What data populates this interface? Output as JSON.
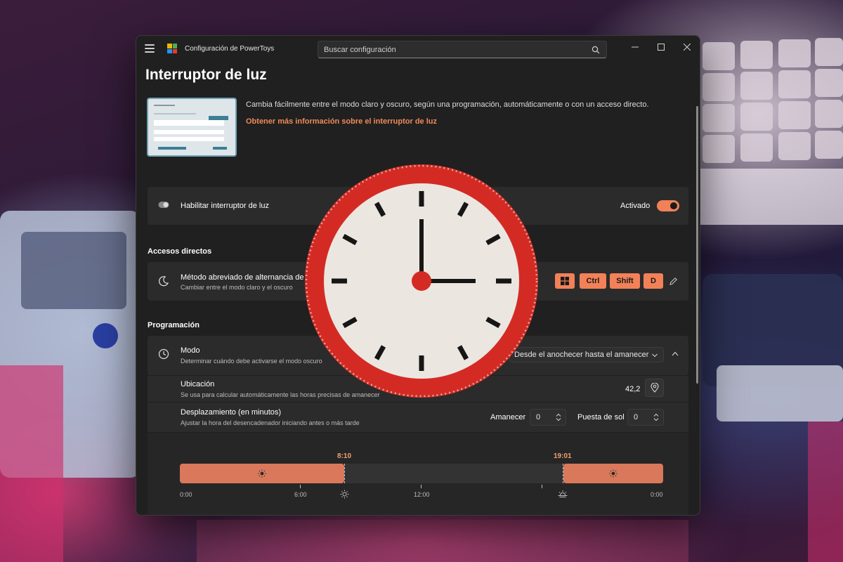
{
  "window": {
    "app_title": "Configuración de PowerToys",
    "search_placeholder": "Buscar configuración"
  },
  "page": {
    "title": "Interruptor de luz",
    "description": "Cambia fácilmente entre el modo claro y oscuro, según una programación, automáticamente o con un acceso directo.",
    "learn_more_link": "Obtener más información sobre el interruptor de luz"
  },
  "enable": {
    "label": "Habilitar interruptor de luz",
    "state_label": "Activado",
    "enabled": true
  },
  "shortcuts": {
    "section_title": "Accesos directos",
    "title": "Método abreviado de alternancia de",
    "subtitle": "Cambiar entre el modo claro y el oscuro",
    "keys": [
      "⊞",
      "Ctrl",
      "Shift",
      "D"
    ]
  },
  "schedule": {
    "section_title": "Programación",
    "mode_title": "Modo",
    "mode_subtitle": "Determinar cuándo debe activarse el modo oscuro",
    "mode_value": "Desde el anochecer hasta el amanecer",
    "location_title": "Ubicación",
    "location_subtitle": "Se usa para calcular automáticamente las horas precisas de amanecer",
    "location_value": "42,2",
    "offset_title": "Desplazamiento (en minutos)",
    "offset_subtitle": "Ajustar la hora del desencadenador iniciando antes o más tarde",
    "sunrise_label": "Amanecer",
    "sunrise_value": "0",
    "sunset_label": "Puesta de sol",
    "sunset_value": "0"
  },
  "timeline": {
    "sunrise_time": "8:10",
    "sunset_time": "19:01",
    "axis_labels": [
      "0:00",
      "6:00",
      "12:00",
      "0:00"
    ]
  },
  "colors": {
    "accent": "#f28158",
    "timeline_light": "#d9785a",
    "window_bg": "#202020",
    "card_bg": "#2b2b2b",
    "clock_rim": "#d32b24"
  },
  "icons": {
    "search": "search-icon",
    "clock_overlay": "clock-icon"
  }
}
